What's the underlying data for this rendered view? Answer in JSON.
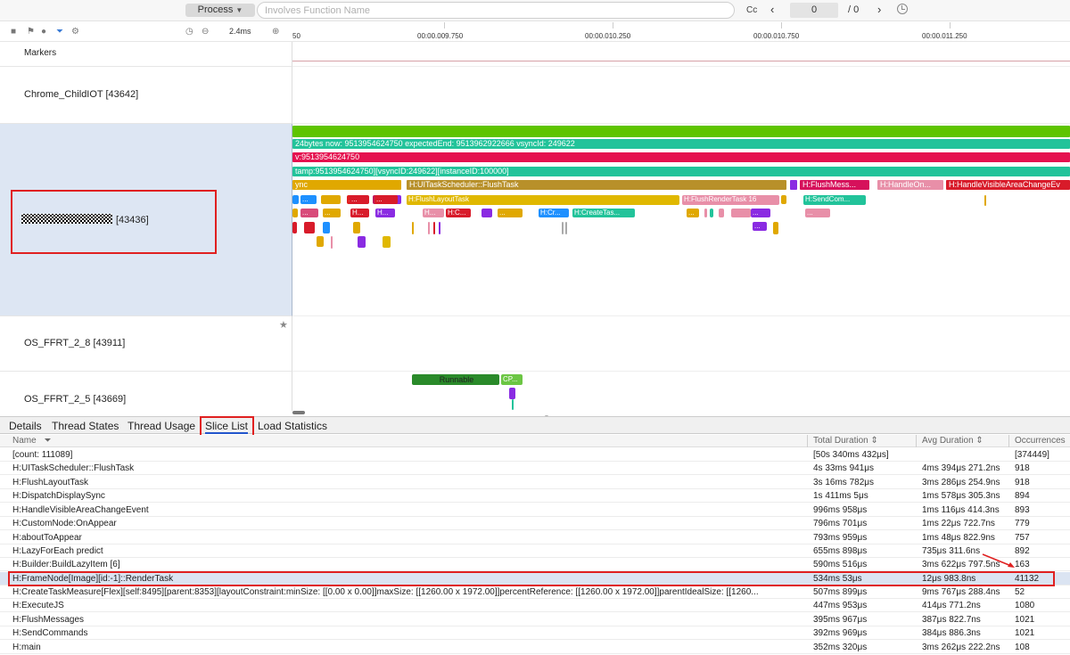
{
  "toolbar": {
    "process_label": "Process",
    "search_placeholder": "Involves Function Name",
    "cc_label": "Cc",
    "prev_icon": "‹",
    "page_current": "0",
    "page_total": "/ 0",
    "next_icon": "›"
  },
  "ruler": {
    "scale_value": "2.4ms",
    "ticks": [
      "50",
      "00:00.009.750",
      "00:00.010.250",
      "00:00.010.750",
      "00:00.011.250"
    ]
  },
  "tracks": {
    "markers": "Markers",
    "chrome": "Chrome_ChildIOT [43642]",
    "masked_process": "[43436]",
    "ffrt_8": "OS_FFRT_2_8 [43911]",
    "ffrt_5": "OS_FFRT_2_5 [43669]"
  },
  "timeline": {
    "row1": "24bytes now: 9513954624750 expectedEnd: 9513962922666 vsyncId: 249622",
    "row2": "v:9513954624750",
    "row3": "tamp:9513954624750][vsyncID:249622][instanceID:100000]",
    "sync": "ync",
    "ui_task": "H:UITaskScheduler::FlushTask",
    "flush_msg": "H:FlushMess...",
    "handle_on": "H:HandleOn...",
    "handle_visible": "H:HandleVisibleAreaChangeEv",
    "flush_layout": "H:FlushLayoutTask",
    "flush_render": "H:FlushRenderTask 16",
    "send_com": "H:SendCom...",
    "ellipsis": "...",
    "h": "H...",
    "h_cr": "H:Cr...",
    "h_c": "H:C...",
    "h_create": "H:CreateTas...",
    "runnable": "Runnable",
    "cp": "CP..."
  },
  "tabs": [
    "Details",
    "Thread States",
    "Thread Usage",
    "Slice List",
    "Load Statistics"
  ],
  "table": {
    "headers": [
      "Name",
      "Total Duration",
      "Avg Duration",
      "Occurrences"
    ],
    "rows": [
      [
        "[count: 111089]",
        "[50s 340ms 432μs]",
        "",
        "[374449]"
      ],
      [
        "H:UITaskScheduler::FlushTask",
        "4s 33ms 941μs",
        "4ms 394μs 271.2ns",
        "918"
      ],
      [
        "H:FlushLayoutTask",
        "3s 16ms 782μs",
        "3ms 286μs 254.9ns",
        "918"
      ],
      [
        "H:DispatchDisplaySync",
        "1s 411ms 5μs",
        "1ms 578μs 305.3ns",
        "894"
      ],
      [
        "H:HandleVisibleAreaChangeEvent",
        "996ms 958μs",
        "1ms 116μs 414.3ns",
        "893"
      ],
      [
        "H:CustomNode:OnAppear",
        "796ms 701μs",
        "1ms 22μs 722.7ns",
        "779"
      ],
      [
        "H:aboutToAppear",
        "793ms 959μs",
        "1ms 48μs 822.9ns",
        "757"
      ],
      [
        "H:LazyForEach predict",
        "655ms 898μs",
        "735μs 311.6ns",
        "892"
      ],
      [
        "H:Builder:BuildLazyItem [6]",
        "590ms 516μs",
        "3ms 622μs 797.5ns",
        "163"
      ],
      [
        "H:FrameNode[Image][id:-1]::RenderTask",
        "534ms 53μs",
        "12μs 983.8ns",
        "41132"
      ],
      [
        "H:CreateTaskMeasure[Flex][self:8495][parent:8353][layoutConstraint:minSize: [[0.00 x 0.00]]maxSize: [[1260.00 x 1972.00]]percentReference: [[1260.00 x 1972.00]]parentIdealSize: [[1260...",
        "507ms 899μs",
        "9ms 767μs 288.4ns",
        "52"
      ],
      [
        "H:ExecuteJS",
        "447ms 953μs",
        "414μs 771.2ns",
        "1080"
      ],
      [
        "H:FlushMessages",
        "395ms 967μs",
        "387μs 822.7ns",
        "1021"
      ],
      [
        "H:SendCommands",
        "392ms 969μs",
        "384μs 886.3ns",
        "1021"
      ],
      [
        "H:main",
        "352ms 320μs",
        "3ms 262μs 222.2ns",
        "108"
      ]
    ]
  },
  "colors": {
    "green": "#5ec400",
    "teal": "#22c39a",
    "red": "#e5114f",
    "gold": "#b8902a",
    "highlight": "#dbe4f2",
    "annotation": "#e02020"
  }
}
